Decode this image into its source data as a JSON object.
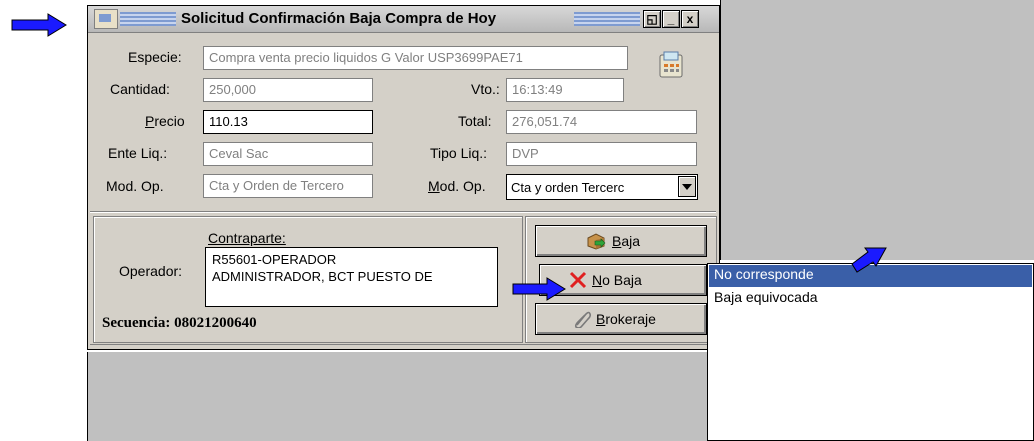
{
  "window": {
    "title": "Solicitud Confirmación Baja Compra de Hoy",
    "controls": [
      "◱",
      "_",
      "x"
    ]
  },
  "form": {
    "especie_label": "Especie:",
    "especie_value": "Compra venta precio liquidos G Valor USP3699PAE71",
    "cantidad_label": "Cantidad:",
    "cantidad_value": "250,000",
    "vto_label": "Vto.:",
    "vto_value": "16:13:49",
    "precio_label_pre": "P",
    "precio_label_post": "recio",
    "precio_value": "110.13",
    "total_label": "Total:",
    "total_value": "276,051.74",
    "ente_label": "Ente Liq.:",
    "ente_value": "Ceval Sac",
    "tipo_label": "Tipo Liq.:",
    "tipo_value": "DVP",
    "modop_label": "Mod. Op.",
    "modop_value": "Cta y Orden de Tercero",
    "modop2_label_pre": "M",
    "modop2_label_post": "od. Op.",
    "modop2_value": "Cta y orden Tercerc"
  },
  "contraparte": {
    "heading": "Contraparte:",
    "operador_label": "Operador:",
    "operador_line1": "R55601-OPERADOR",
    "operador_line2": "ADMINISTRADOR, BCT PUESTO DE",
    "secuencia": "Secuencia: 08021200640"
  },
  "buttons": {
    "baja_pre": "B",
    "baja_post": "aja",
    "nobaja_pre": "N",
    "nobaja_post": "o Baja",
    "brokeraje_pre": "B",
    "brokeraje_post": "rokeraje"
  },
  "dropdown": {
    "items": [
      "No corresponde",
      "Baja equivocada"
    ],
    "selected_index": 0
  },
  "colors": {
    "arrow": "#1a1aff",
    "selection": "#3a5fa8"
  }
}
